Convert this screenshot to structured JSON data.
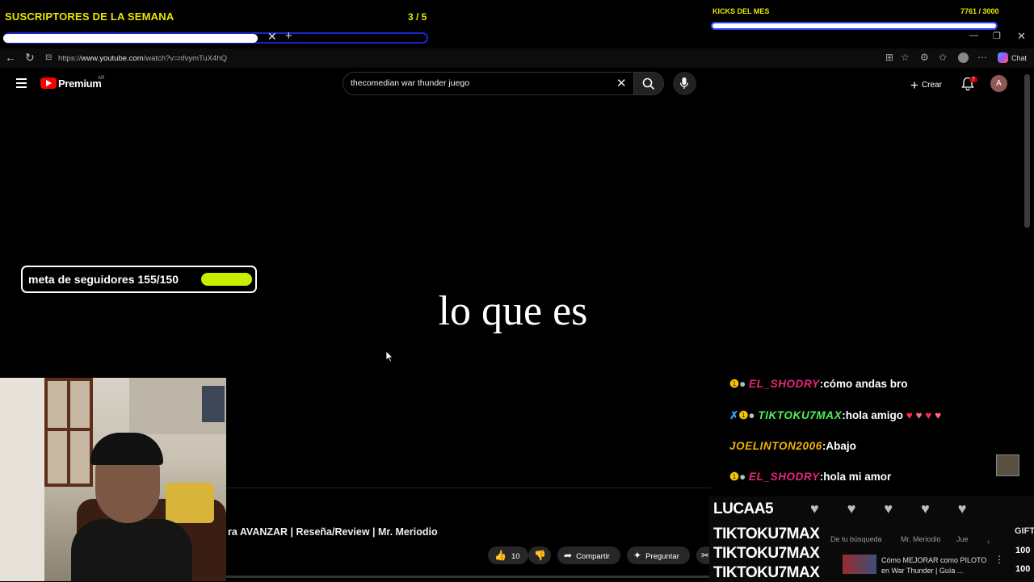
{
  "overlay": {
    "subs_title": "SUSCRIPTORES DE LA SEMANA",
    "subs_count": "3 / 5",
    "kicks_title": "KICKS DEL MES",
    "kicks_count": "7761 / 3000",
    "kicks_progress": 1.0,
    "meta_label": "meta de seguidores 155/150",
    "meta_progress": 1.0
  },
  "browser": {
    "url_prefix": "https://",
    "url_domain": "www.youtube.com",
    "url_path": "/watch?v=nfvymTuX4hQ",
    "chat_label": "Chat",
    "tab_add": "+",
    "tab_close": "✕"
  },
  "youtube": {
    "logo_text": "Premium",
    "country": "AR",
    "search_value": "thecomedian war thunder juego",
    "create_label": "Crear",
    "notif_count": "7",
    "avatar_letter": "A",
    "video_title": "ra AVANZAR | Reseña/Review | Mr. Meriodio",
    "like_count": "10",
    "share_label": "Compartir",
    "ask_label": "Preguntar",
    "chips": [
      "De tu búsqueda",
      "Mr. Meriodio",
      "Jue"
    ],
    "rec_title_1": "Cómo MEJORAR como PILOTO",
    "rec_title_2": "en War Thunder | Guía ..."
  },
  "video": {
    "subtitle": "lo que es"
  },
  "chat": [
    {
      "user": "EL_SHODRY",
      "message": "cómo andas bro"
    },
    {
      "user": "TIKTOKU7MAX",
      "message": "hola amigo"
    },
    {
      "user": "JOELINTON2006",
      "message": "Abajo"
    },
    {
      "user": "EL_SHODRY",
      "message": "hola mi amor"
    }
  ],
  "leaderboard": {
    "entries": [
      "LUCAA5",
      "TIKTOKU7MAX",
      "TIKTOKU7MAX",
      "TIKTOKU7MAX"
    ],
    "gift_label": "GIFT",
    "values": [
      "100",
      "100"
    ]
  }
}
